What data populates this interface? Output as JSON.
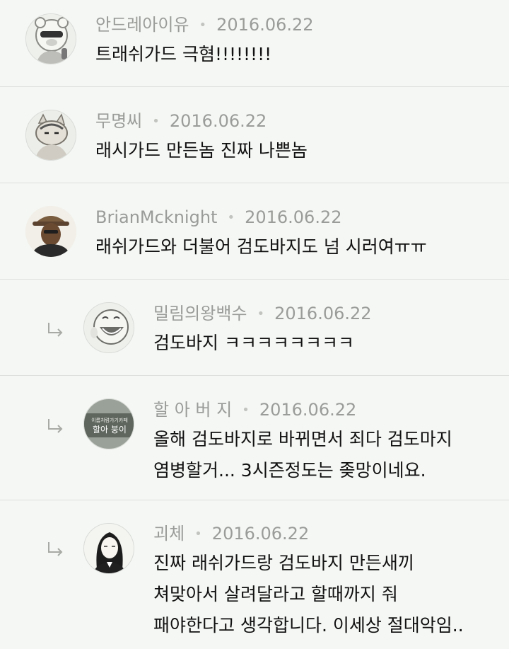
{
  "comments": [
    {
      "author": "안드레아이유",
      "date": "2016.06.22",
      "text": "트래쉬가드 극혐!!!!!!!!",
      "avatar": "bear-character-avatar",
      "reply": false
    },
    {
      "author": "무명씨",
      "date": "2016.06.22",
      "text": "래시가드 만든놈 진짜 나쁜놈",
      "avatar": "cat-character-avatar",
      "reply": false
    },
    {
      "author": "BrianMcknight",
      "date": "2016.06.22",
      "text": "래쉬가드와 더불어 검도바지도 넘 시러여ㅠㅠ",
      "avatar": "man-with-hat-photo-avatar",
      "reply": false
    },
    {
      "author": "밀림의왕백수",
      "date": "2016.06.22",
      "text": "검도바지 ㅋㅋㅋㅋㅋㅋㅋㅋ",
      "avatar": "laughing-face-avatar",
      "reply": true
    },
    {
      "author": "할 아 버 지",
      "date": "2016.06.22",
      "text": "올해 검도바지로 바뀌면서 죄다 검도마지\n염병할거... 3시즌정도는 좆망이네요.",
      "avatar": "cafe-sign-avatar",
      "avatar_sign_top": "이름처럼가기카페",
      "avatar_sign_main": "할아 붕이",
      "reply": true
    },
    {
      "author": "괴체",
      "date": "2016.06.22",
      "text": "진짜 래쉬가드랑 검도바지 만든새끼\n쳐맞아서 살려달라고 할때까지 줘\n패야한다고 생각합니다. 이세상 절대악임..",
      "avatar": "long-hair-illustration-avatar",
      "reply": true
    }
  ],
  "colors": {
    "background": "#f4f7f3",
    "divider": "#dcdfdb",
    "meta_text": "#9a9c99",
    "body_text": "#111111"
  }
}
